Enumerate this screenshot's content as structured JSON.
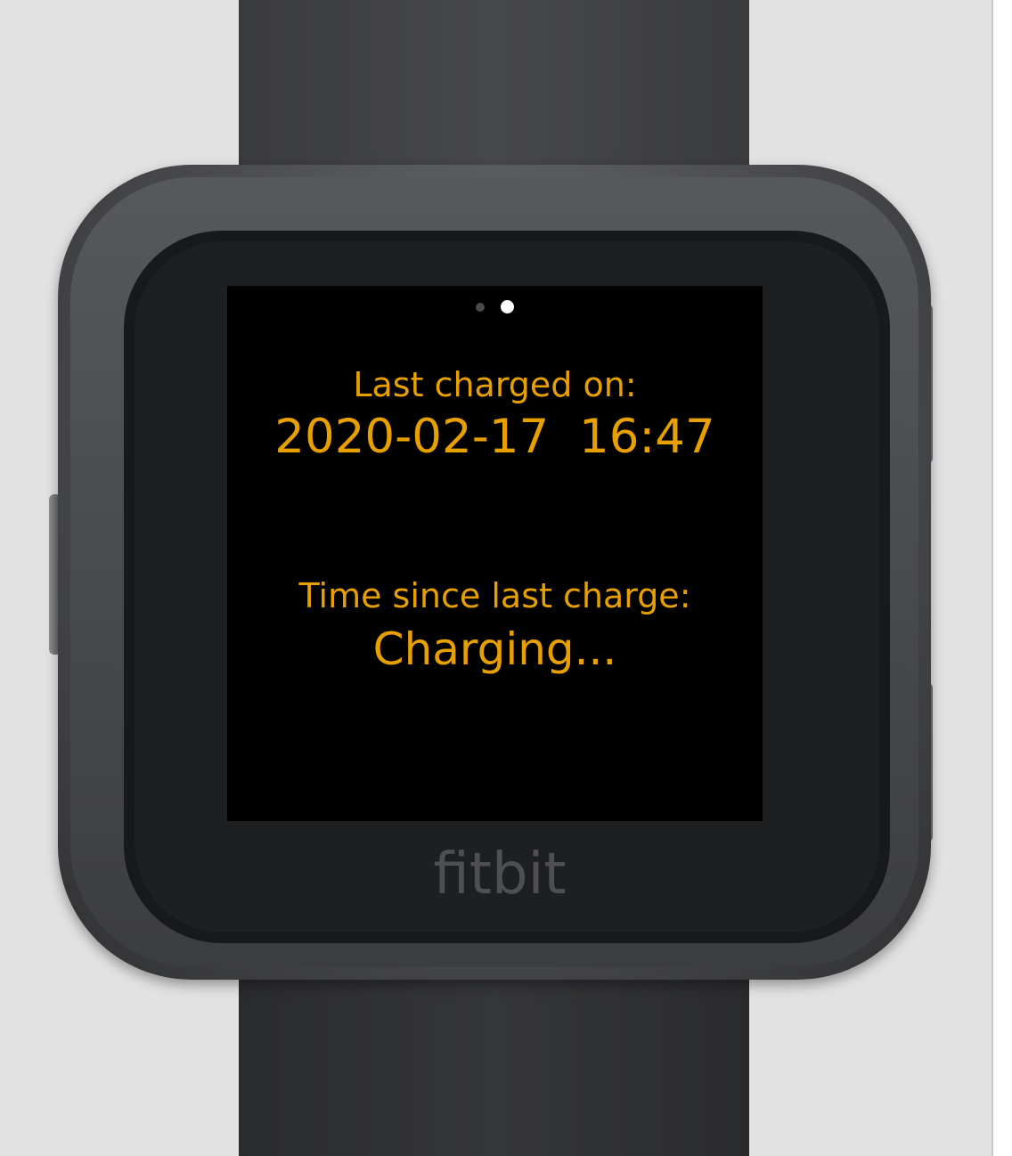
{
  "device": {
    "brand_logo_text": "fitbit",
    "case_color": "#4c4d50",
    "band_color": "#3a3b3d",
    "accent_color": "#e8a000"
  },
  "pager": {
    "total_pages": 2,
    "active_page": 2
  },
  "screen": {
    "last_charged_label": "Last charged on:",
    "last_charged_value": "2020-02-17  16:47",
    "time_since_label": "Time since last charge:",
    "time_since_value": "Charging..."
  }
}
